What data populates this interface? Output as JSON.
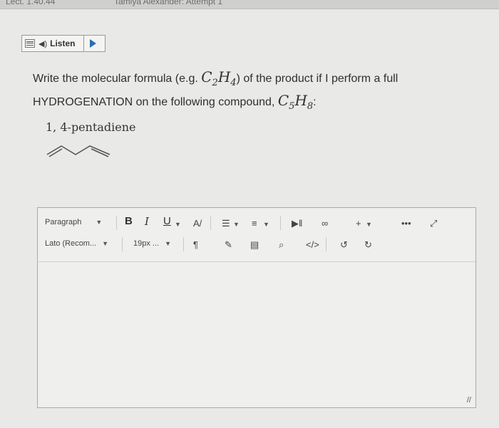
{
  "header": {
    "left_text": "Lect. 1.40.44",
    "center_text": "Tamiya Alexander: Attempt 1"
  },
  "listen": {
    "label": "Listen"
  },
  "question": {
    "part1": "Write the molecular formula (e.g. ",
    "eg_formula": "C2H4",
    "part2": ") of the product if I perform a full HYDROGENATION on the following compound, ",
    "compound_formula": "C5H8",
    "part3": ":"
  },
  "compound_name": "1, 4-pentadiene",
  "editor": {
    "paragraph_select": "Paragraph",
    "font_select": "Lato (Recom...",
    "size_select": "19px ...",
    "bold": "B",
    "italic": "I",
    "underline": "U",
    "plus": "+",
    "more": "•••",
    "code": "</>"
  }
}
